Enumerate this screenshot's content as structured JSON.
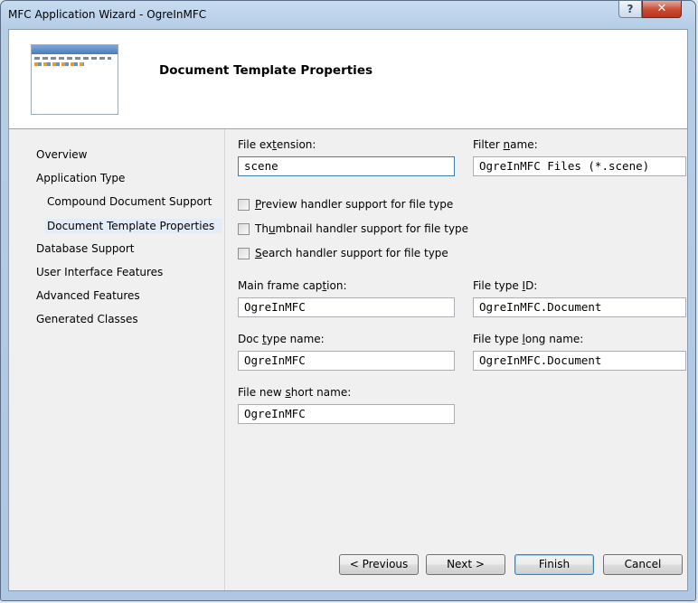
{
  "window": {
    "title": "MFC Application Wizard - OgreInMFC",
    "help_glyph": "?",
    "close_glyph": "✕"
  },
  "header": {
    "title": "Document Template Properties"
  },
  "nav": {
    "items": [
      {
        "label": "Overview"
      },
      {
        "label": "Application Type"
      },
      {
        "label": "Compound Document Support"
      },
      {
        "label": "Document Template Properties"
      },
      {
        "label": "Database Support"
      },
      {
        "label": "User Interface Features"
      },
      {
        "label": "Advanced Features"
      },
      {
        "label": "Generated Classes"
      }
    ]
  },
  "form": {
    "file_extension": {
      "label_pre": "File ex",
      "label_key": "t",
      "label_post": "ension:",
      "value": "scene"
    },
    "filter_name": {
      "label_pre": "Filter ",
      "label_key": "n",
      "label_post": "ame:",
      "value": "OgreInMFC Files (*.scene)"
    },
    "preview_handler": {
      "pre": "",
      "key": "P",
      "post": "review handler support for file type",
      "checked": false
    },
    "thumbnail_handler": {
      "pre": "Th",
      "key": "u",
      "post": "mbnail handler support for file type",
      "checked": false
    },
    "search_handler": {
      "pre": "",
      "key": "S",
      "post": "earch handler support for file type",
      "checked": false
    },
    "main_frame_caption": {
      "label_pre": "Main frame cap",
      "label_key": "t",
      "label_post": "ion:",
      "value": "OgreInMFC"
    },
    "file_type_id": {
      "label_pre": "File type ",
      "label_key": "I",
      "label_post": "D:",
      "value": "OgreInMFC.Document"
    },
    "doc_type_name": {
      "label_pre": "Doc ",
      "label_key": "t",
      "label_post": "ype name:",
      "value": "OgreInMFC"
    },
    "file_type_long_name": {
      "label_pre": "File type ",
      "label_key": "l",
      "label_post": "ong name:",
      "value": "OgreInMFC.Document"
    },
    "file_new_short_name": {
      "label_pre": "File new ",
      "label_key": "s",
      "label_post": "hort name:",
      "value": "OgreInMFC"
    }
  },
  "buttons": {
    "previous": "< Previous",
    "next": "Next >",
    "finish": "Finish",
    "cancel": "Cancel"
  }
}
